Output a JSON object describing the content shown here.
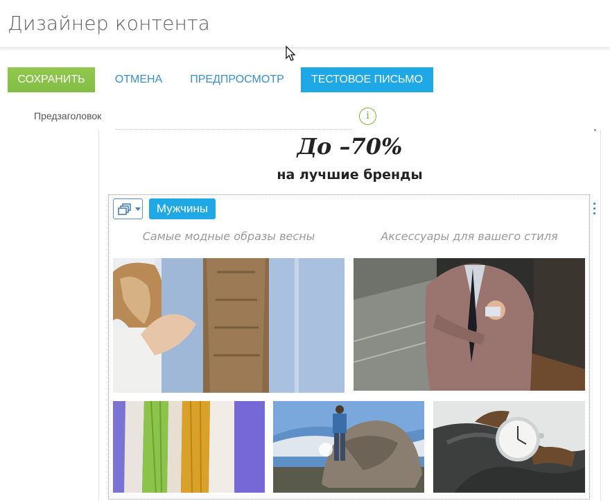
{
  "header": {
    "title": "Дизайнер контента"
  },
  "toolbar": {
    "save_label": "СОХРАНИТЬ",
    "cancel_label": "ОТМЕНА",
    "preview_label": "ПРЕДПРОСМОТР",
    "test_email_label": "ТЕСТОВОЕ ПИСЬМО"
  },
  "preheader": {
    "label": "Предзаголовок",
    "info_icon": "info-icon"
  },
  "content": {
    "promo_title": "До –70%",
    "promo_subtitle": "на лучшие бренды",
    "block": {
      "type_icon": "copy-icon",
      "segment_label": "Мужчины",
      "captions": [
        "Самые модные образы весны",
        "Аксессуары для вашего стиля"
      ],
      "images": [
        "couple-photo",
        "suit-photo",
        "shirts-photo",
        "rock-photo",
        "watch-photo"
      ]
    }
  },
  "colors": {
    "save_button": "#8bc34a",
    "primary_button": "#1ea8e6",
    "link_button": "#3a8dc5",
    "info_icon": "#7cb342"
  }
}
